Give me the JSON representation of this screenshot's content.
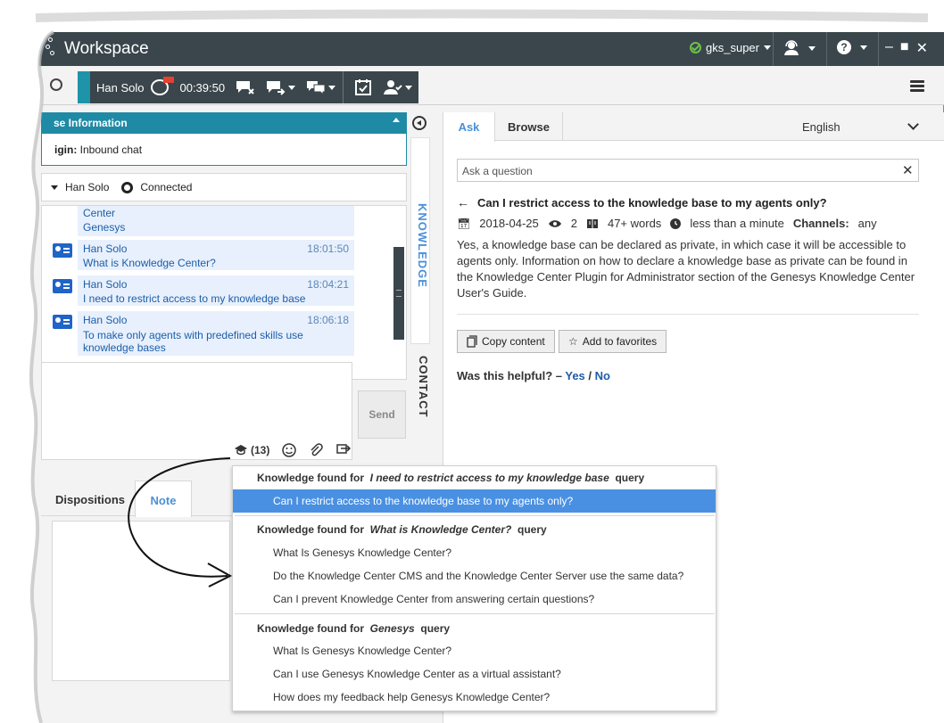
{
  "titlebar": {
    "app_name": "Workspace",
    "user": "gks_super",
    "user_status_color": "#6cc04a",
    "icons": [
      "logo-icon",
      "status-ok-icon",
      "agent-status-icon",
      "help-icon",
      "minimize-icon",
      "maximize-icon",
      "close-icon"
    ]
  },
  "toolbar": {
    "contact_name": "Han Solo",
    "timer": "00:39:50"
  },
  "case": {
    "header": "se Information",
    "origin_label": "igin:",
    "origin_value": "Inbound chat"
  },
  "party": {
    "name": "Han Solo",
    "status": "Connected"
  },
  "transcript": {
    "partial_lines": [
      "Center",
      "Genesys"
    ],
    "messages": [
      {
        "sender": "Han Solo",
        "time": "18:01:50",
        "text": "What is Knowledge Center?"
      },
      {
        "sender": "Han Solo",
        "time": "18:04:21",
        "text": "I need to restrict access to my knowledge base"
      },
      {
        "sender": "Han Solo",
        "time": "18:06:18",
        "text": "To make only agents with predefined skills use knowledge bases"
      }
    ]
  },
  "compose": {
    "send_label": "Send",
    "kb_count": "(13)"
  },
  "bottom_tabs": {
    "dispositions": "Dispositions",
    "note": "Note"
  },
  "side_tabs": {
    "knowledge": "KNOWLEDGE",
    "contact": "CONTACT"
  },
  "knowledge": {
    "tab_ask": "Ask",
    "tab_browse": "Browse",
    "language": "English",
    "search_placeholder": "Ask a question",
    "article": {
      "title": "Can I restrict access to the knowledge base to my agents only?",
      "date": "2018-04-25",
      "views": "2",
      "words": "47+ words",
      "read_time": "less than a minute",
      "channels_label": "Channels:",
      "channels_value": "any",
      "body": "Yes, a knowledge base can be declared as private, in which case it will be accessible to agents only. Information on how to declare a knowledge base as private can be found in the Knowledge Center Plugin for Administrator section of the Genesys Knowledge Center User's Guide."
    },
    "copy_label": "Copy content",
    "favorites_label": "Add to favorites",
    "helpful_label": "Was this helpful? –",
    "yes_label": "Yes",
    "slash": "/",
    "no_label": "No"
  },
  "dropdown": {
    "prefix": "Knowledge found for",
    "suffix": "query",
    "groups": [
      {
        "query": "I need to restrict access to my knowledge base",
        "items": [
          "Can I restrict access to the knowledge base to my agents only?"
        ]
      },
      {
        "query": "What is Knowledge Center?",
        "items": [
          "What Is Genesys Knowledge Center?",
          "Do the Knowledge Center CMS and the Knowledge Center Server use the same data?",
          "Can I prevent Knowledge Center from answering certain questions?"
        ]
      },
      {
        "query": "Genesys",
        "items": [
          "What Is Genesys Knowledge Center?",
          "Can I use Genesys Knowledge Center as a virtual assistant?",
          "How does my feedback help Genesys Knowledge Center?"
        ]
      }
    ]
  },
  "colors": {
    "titlebar": "#3a464c",
    "accent": "#1f8aa6",
    "link": "#4a90d9",
    "selection": "#4a90e2",
    "chat_bubble": "#e8f0fd"
  }
}
